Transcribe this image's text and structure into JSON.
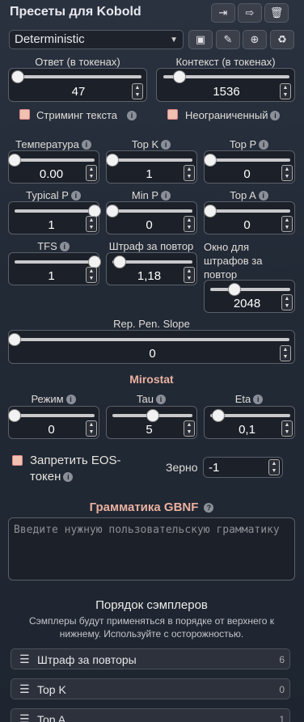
{
  "header": {
    "title": "Пресеты для Kobold"
  },
  "preset": {
    "selected": "Deterministic"
  },
  "response": {
    "label": "Ответ (в токенах)",
    "value": "47"
  },
  "context": {
    "label": "Контекст (в токенах)",
    "value": "1536"
  },
  "streaming": {
    "label": "Стриминг текста"
  },
  "unlimited": {
    "label": "Неограниченный"
  },
  "temperature": {
    "label": "Температура",
    "value": "0.00"
  },
  "topk": {
    "label": "Top K",
    "value": "1"
  },
  "topp": {
    "label": "Top P",
    "value": "0"
  },
  "typicalp": {
    "label": "Typical P",
    "value": "1"
  },
  "minp": {
    "label": "Min P",
    "value": "0"
  },
  "topa": {
    "label": "Top A",
    "value": "0"
  },
  "tfs": {
    "label": "TFS",
    "value": "1"
  },
  "reppen": {
    "label": "Штраф за повтор",
    "value": "1,18"
  },
  "reppenrange": {
    "label": "Окно для штрафов за повтор",
    "value": "2048"
  },
  "reppenslope": {
    "label": "Rep. Pen. Slope",
    "value": "0"
  },
  "mirostat": {
    "title": "Mirostat",
    "mode": {
      "label": "Режим",
      "value": "0"
    },
    "tau": {
      "label": "Tau",
      "value": "5"
    },
    "eta": {
      "label": "Eta",
      "value": "0,1"
    }
  },
  "eos": {
    "label": "Запретить EOS-токен"
  },
  "seed": {
    "label": "Зерно",
    "value": "-1"
  },
  "grammar": {
    "title": "Грамматика GBNF",
    "placeholder": "Введите нужную пользовательскую грамматику"
  },
  "sampler_order": {
    "title": "Порядок сэмплеров",
    "description": "Сэмплеры будут применяться в порядке от верхнего к нижнему. Используйте с осторожностью.",
    "items": [
      {
        "name": "Штраф за повторы",
        "index": "6"
      },
      {
        "name": "Top K",
        "index": "0"
      },
      {
        "name": "Top A",
        "index": "1"
      }
    ]
  },
  "slider_levels": {
    "response": 0.02,
    "context": 0.13,
    "temperature": 0,
    "topk": 0,
    "topp": 0,
    "typicalp": 1,
    "minp": 0,
    "topa": 0,
    "tfs": 1,
    "reppen": 0.09,
    "reppenrange": 0.3,
    "reppenslope": 0,
    "mode": 0,
    "tau": 0.5,
    "eta": 0.1
  }
}
